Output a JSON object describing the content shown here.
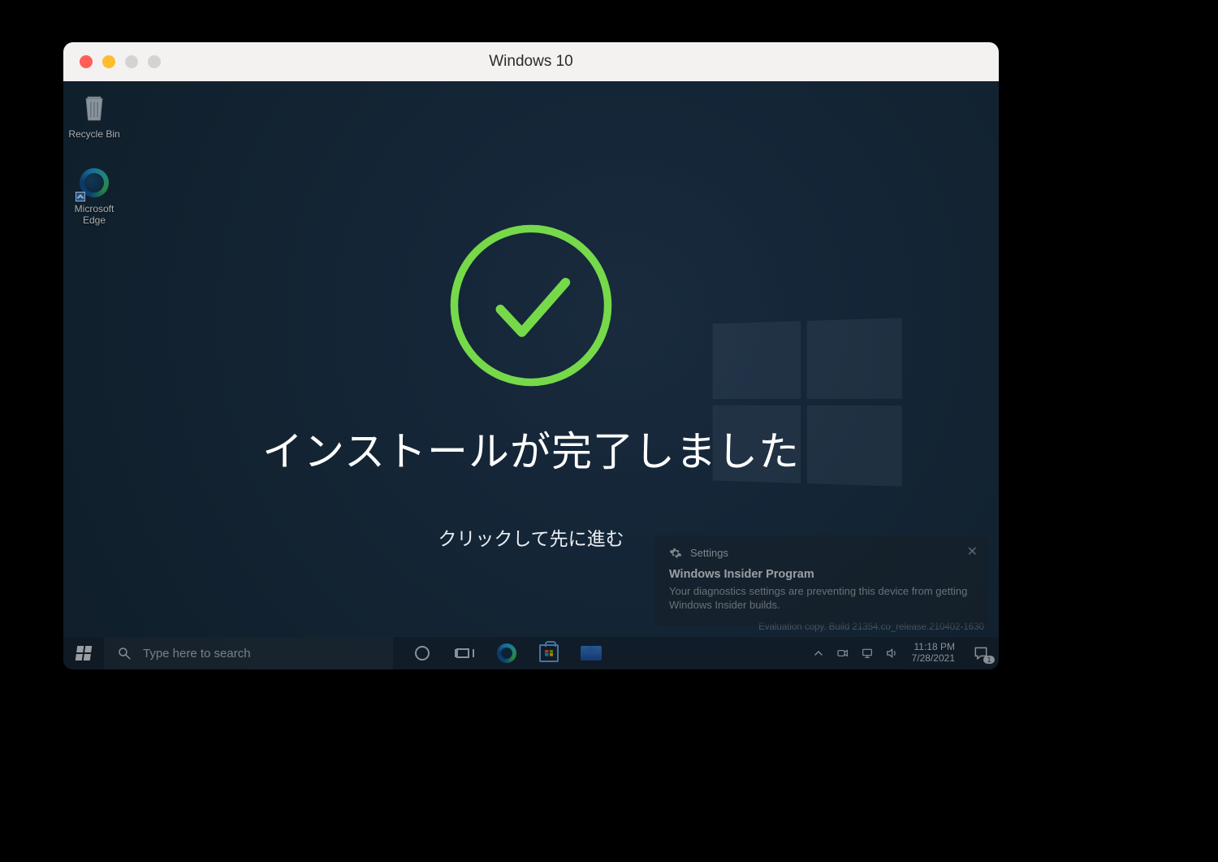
{
  "window": {
    "title": "Windows 10"
  },
  "desktop": {
    "icons": {
      "recycle_bin": "Recycle Bin",
      "edge": "Microsoft Edge"
    },
    "watermark_line2": "Evaluation copy. Build 21354.co_release.210402-1630"
  },
  "overlay": {
    "title": "インストールが完了しました",
    "subtitle": "クリックして先に進む"
  },
  "toast": {
    "app": "Settings",
    "title": "Windows Insider Program",
    "body": "Your diagnostics settings are preventing this device from getting Windows Insider builds."
  },
  "taskbar": {
    "search_placeholder": "Type here to search",
    "time": "11:18 PM",
    "date": "7/28/2021",
    "notification_count": "1"
  }
}
